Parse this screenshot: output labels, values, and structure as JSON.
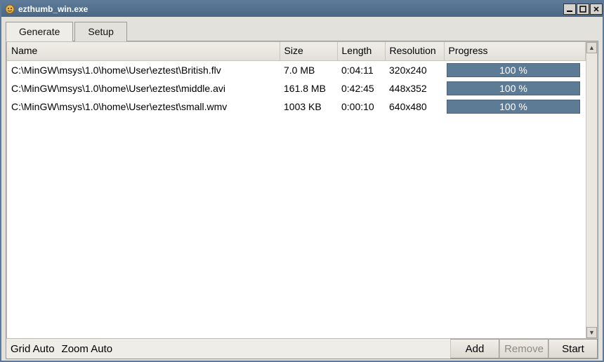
{
  "window": {
    "title": "ezthumb_win.exe"
  },
  "tabs": [
    {
      "label": "Generate",
      "active": true
    },
    {
      "label": "Setup",
      "active": false
    }
  ],
  "table": {
    "columns": [
      "Name",
      "Size",
      "Length",
      "Resolution",
      "Progress"
    ],
    "rows": [
      {
        "name": "C:\\MinGW\\msys\\1.0\\home\\User\\eztest\\British.flv",
        "size": "7.0 MB",
        "length": "0:04:11",
        "resolution": "320x240",
        "progress": "100 %"
      },
      {
        "name": "C:\\MinGW\\msys\\1.0\\home\\User\\eztest\\middle.avi",
        "size": "161.8 MB",
        "length": "0:42:45",
        "resolution": "448x352",
        "progress": "100 %"
      },
      {
        "name": "C:\\MinGW\\msys\\1.0\\home\\User\\eztest\\small.wmv",
        "size": "1003 KB",
        "length": "0:00:10",
        "resolution": "640x480",
        "progress": "100 %"
      }
    ]
  },
  "status": {
    "grid": "Grid Auto",
    "zoom": "Zoom Auto"
  },
  "buttons": {
    "add": "Add",
    "remove": "Remove",
    "start": "Start"
  },
  "colors": {
    "titlebar": "#5d7b99",
    "progress": "#5e7b96"
  }
}
